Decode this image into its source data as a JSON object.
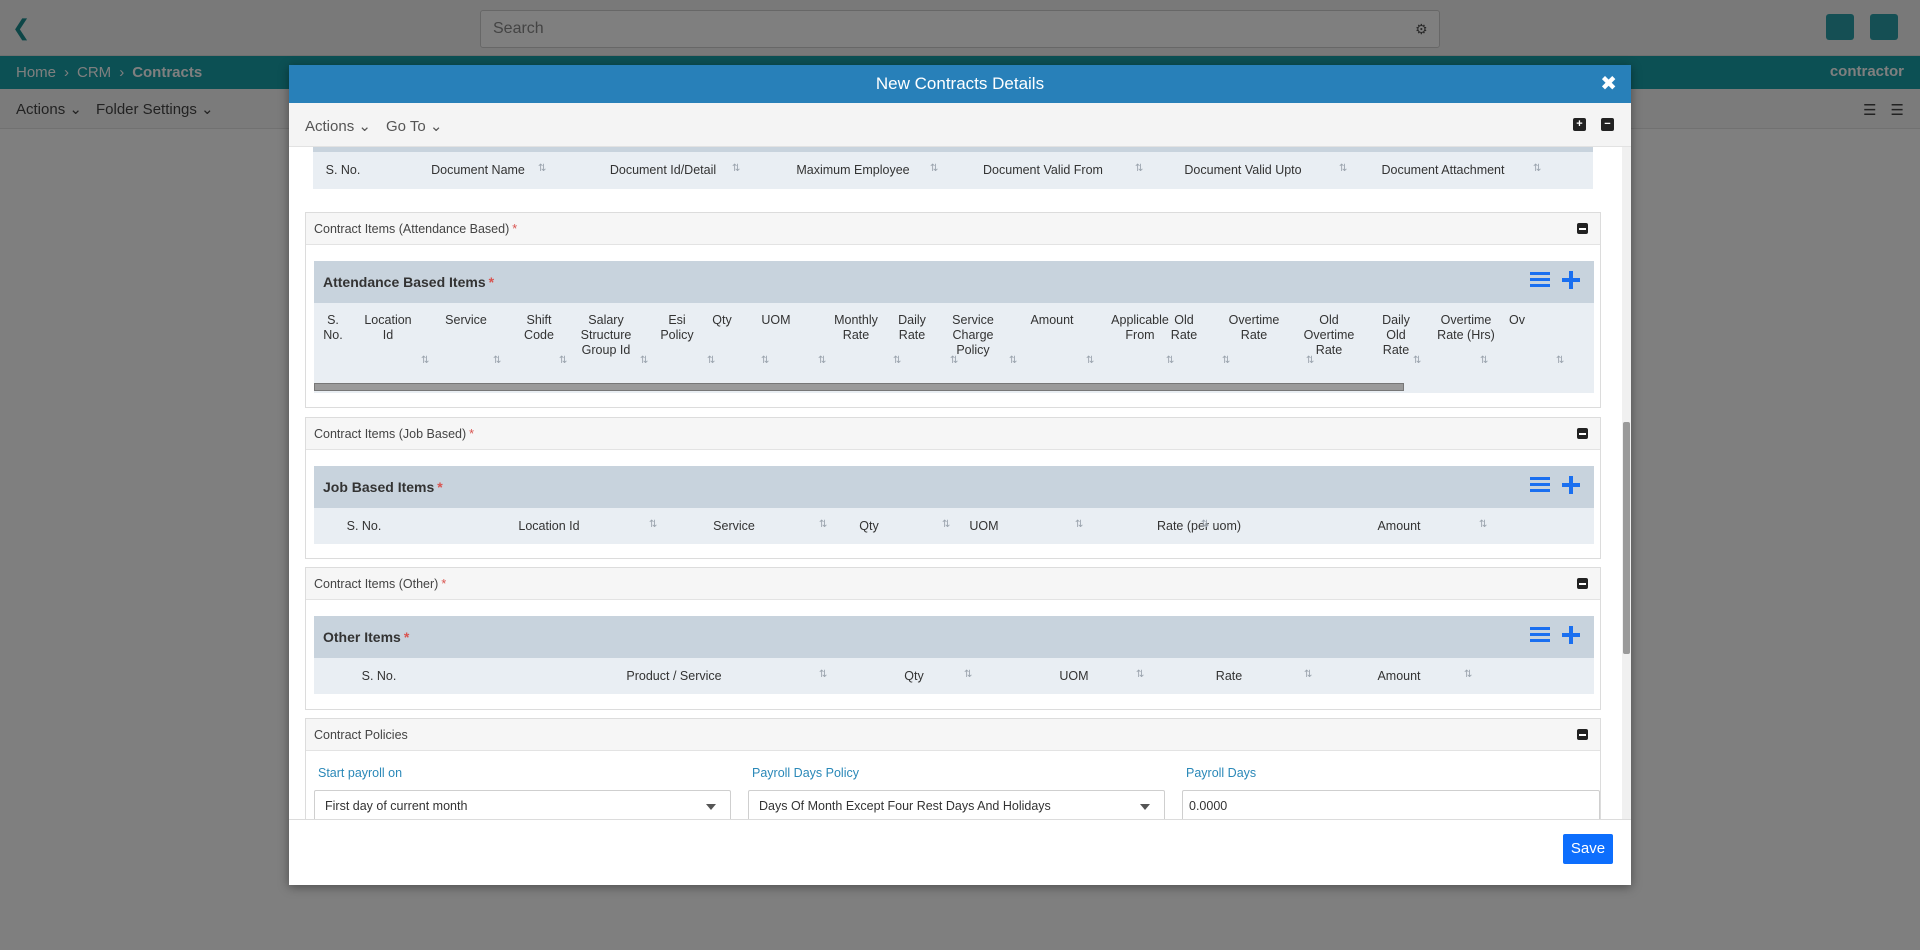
{
  "app": {
    "search_placeholder": "Search",
    "breadcrumb": [
      "Home",
      "CRM",
      "Contracts"
    ],
    "user": "contractor",
    "actions_label": "Actions",
    "folder_settings_label": "Folder Settings"
  },
  "modal": {
    "title": "New Contracts Details",
    "toolbar": {
      "actions": "Actions",
      "goto": "Go To"
    },
    "save_label": "Save"
  },
  "documents_grid": {
    "columns": [
      "S. No.",
      "Document Name",
      "Document Id/Detail",
      "Maximum Employee",
      "Document Valid From",
      "Document Valid Upto",
      "Document Attachment"
    ]
  },
  "attendance": {
    "panel_title": "Contract Items (Attendance Based)",
    "grid_title": "Attendance Based Items",
    "columns": [
      "S. No.",
      "Location Id",
      "Service",
      "Shift Code",
      "Salary Structure Group Id",
      "Esi Policy",
      "Qty",
      "UOM",
      "Monthly Rate",
      "Daily Rate",
      "Service Charge Policy",
      "Amount",
      "Applicable From",
      "Old Rate",
      "Overtime Rate",
      "Old Overtime Rate",
      "Daily Old Rate",
      "Overtime Rate (Hrs)",
      "Ov"
    ]
  },
  "job": {
    "panel_title": "Contract Items (Job Based)",
    "grid_title": "Job Based Items",
    "columns": [
      "S. No.",
      "Location Id",
      "Service",
      "Qty",
      "UOM",
      "Rate (per uom)",
      "Amount"
    ]
  },
  "other": {
    "panel_title": "Contract Items (Other)",
    "grid_title": "Other Items",
    "columns": [
      "S. No.",
      "Product / Service",
      "Qty",
      "UOM",
      "Rate",
      "Amount"
    ]
  },
  "policies": {
    "panel_title": "Contract Policies",
    "start_payroll_label": "Start payroll on",
    "start_payroll_value": "First day of current month",
    "payroll_days_policy_label": "Payroll Days Policy",
    "payroll_days_policy_value": "Days Of Month Except Four Rest Days And Holidays",
    "payroll_days_label": "Payroll Days",
    "payroll_days_value": "0.0000"
  },
  "required_mark": "*"
}
